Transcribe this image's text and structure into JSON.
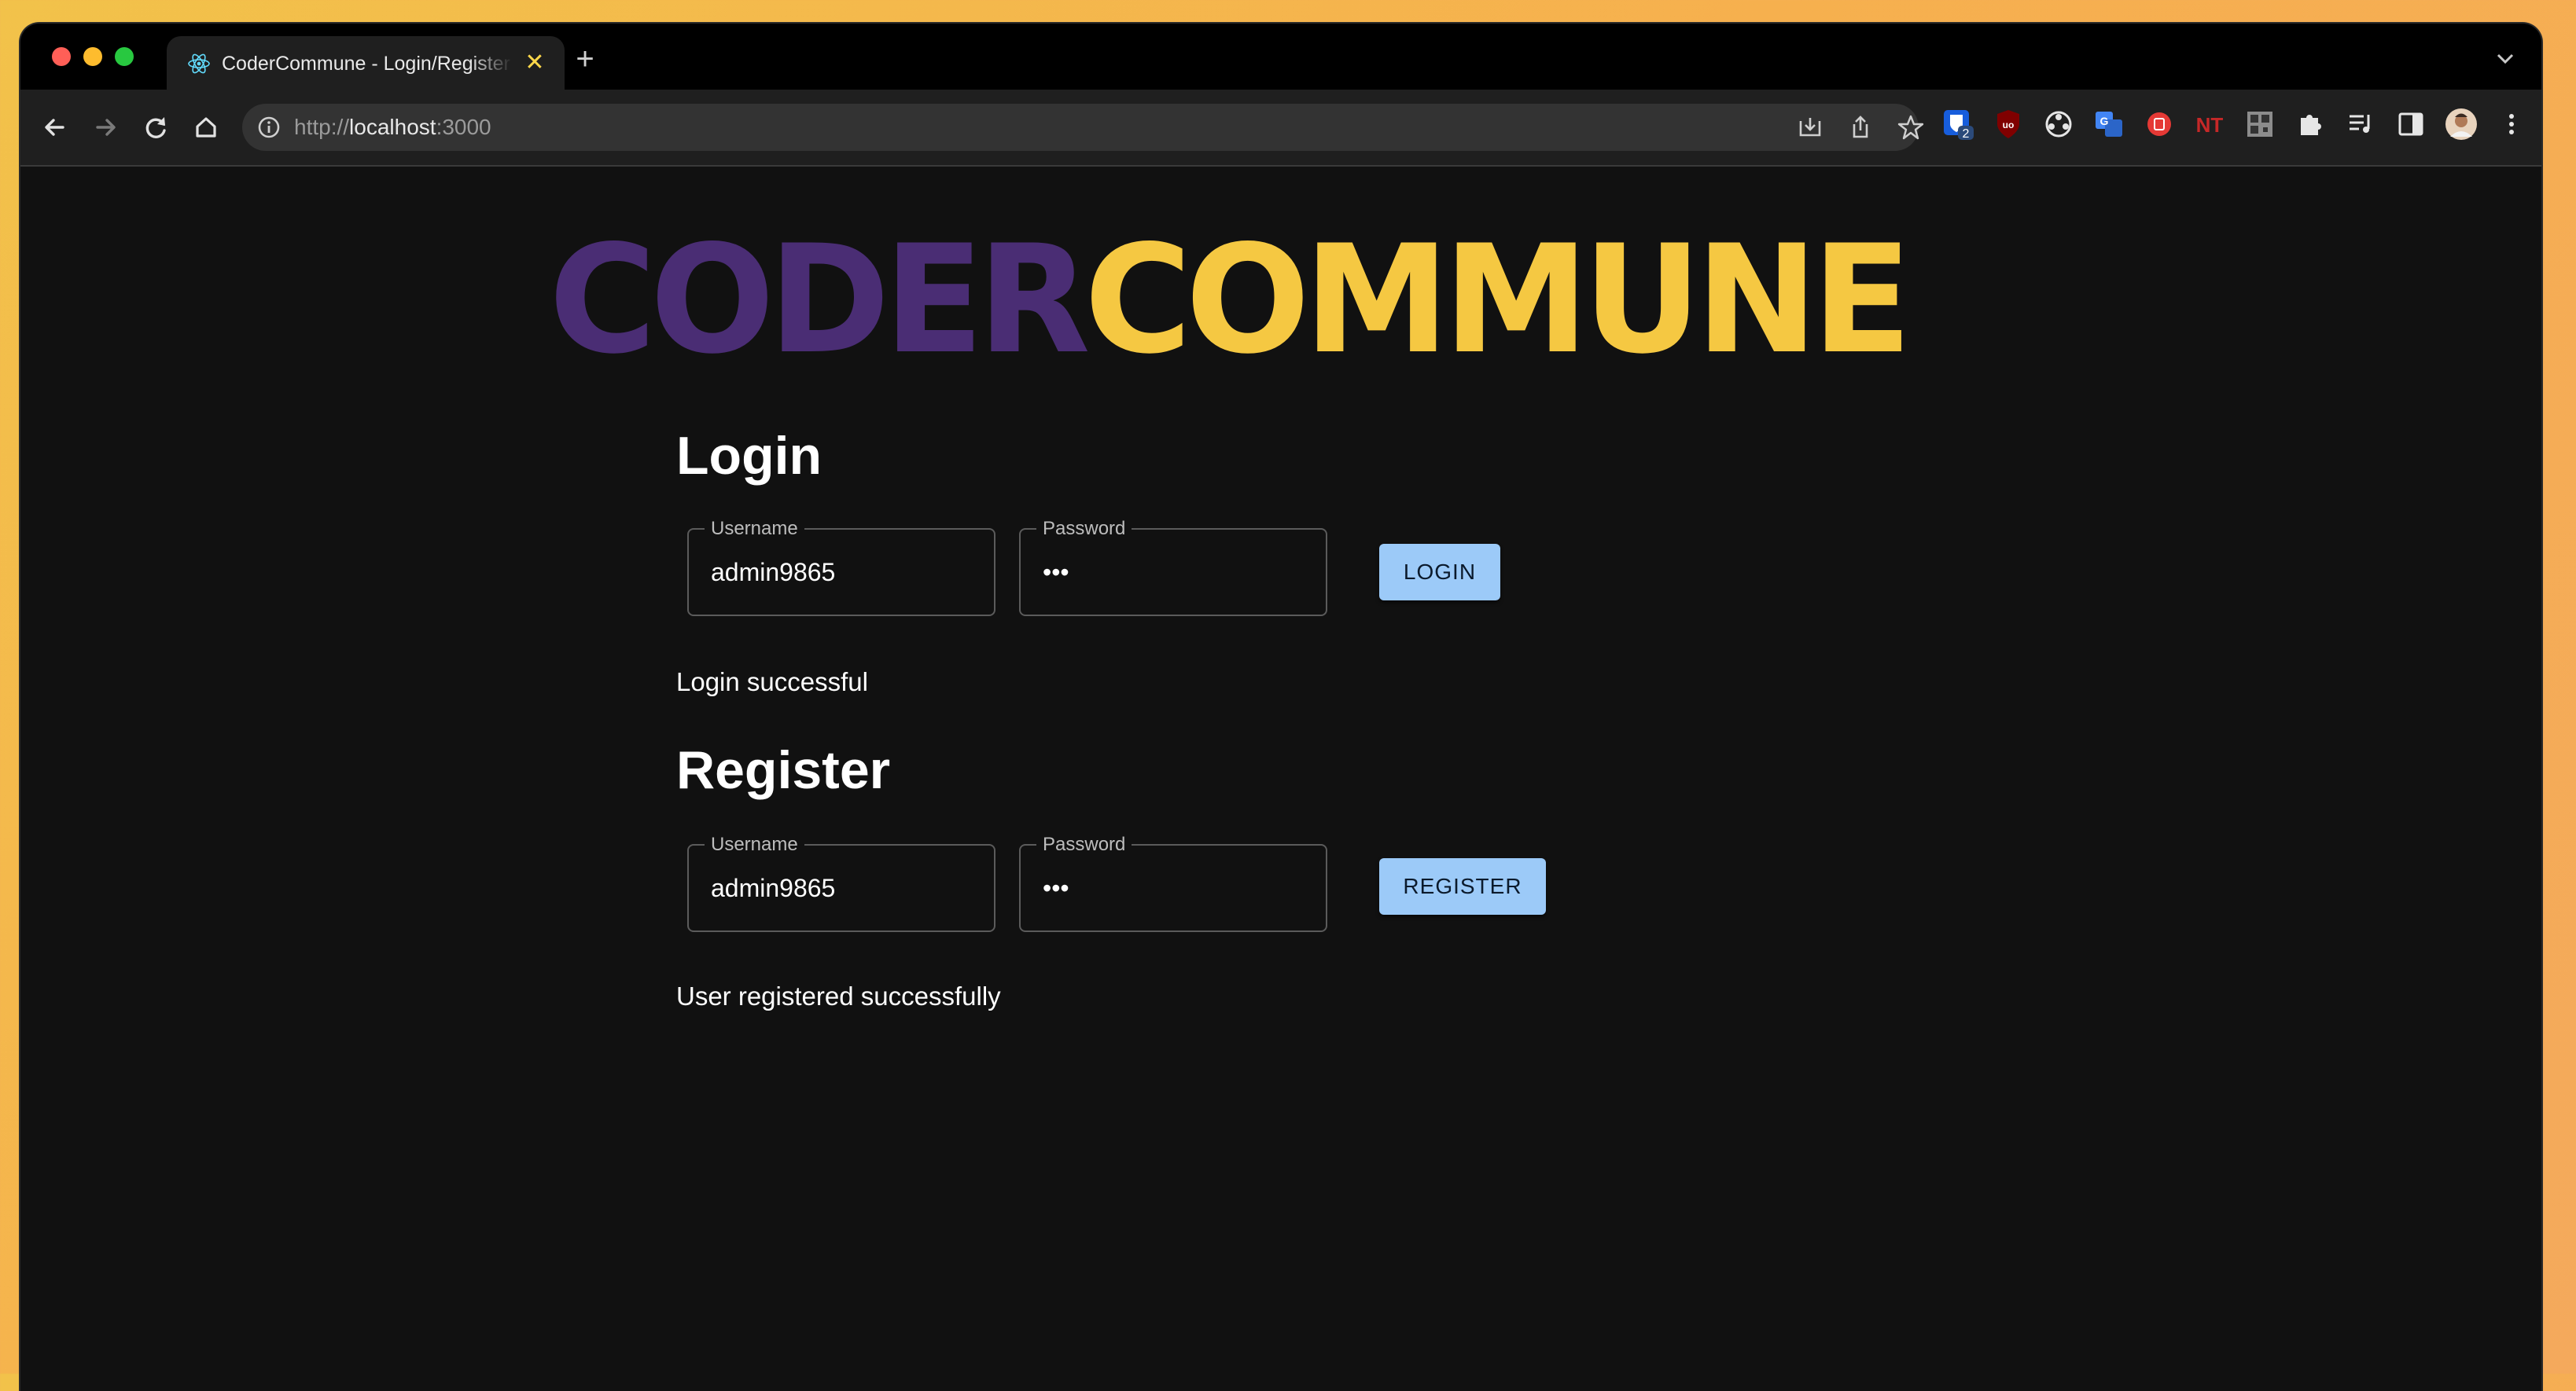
{
  "browser": {
    "tab_title": "CoderCommune - Login/Register",
    "tab_close": "✕",
    "new_tab": "+",
    "url_scheme": "http://",
    "url_host": "localhost",
    "url_port": ":3000",
    "extensions": [
      "bitwarden-icon",
      "ublock-icon",
      "extension-icon",
      "translate-icon",
      "adblock-icon",
      "netflix-icon",
      "qr-icon",
      "puzzle-icon",
      "media-icon",
      "sidepanel-icon",
      "profile-avatar",
      "menu-icon"
    ],
    "bitwarden_badge": "2",
    "netflix_label": "NT"
  },
  "logo": {
    "part1": "CODER",
    "part2": "COMMUNE"
  },
  "login": {
    "heading": "Login",
    "username_label": "Username",
    "username_value": "admin9865",
    "password_label": "Password",
    "password_value": "•••",
    "button_label": "LOGIN",
    "status": "Login successful"
  },
  "register": {
    "heading": "Register",
    "username_label": "Username",
    "username_value": "admin9865",
    "password_label": "Password",
    "password_value": "•••",
    "button_label": "REGISTER",
    "status": "User registered successfully"
  },
  "colors": {
    "logo_purple": "#4a2d74",
    "logo_yellow": "#f5c842",
    "button_bg": "#9ccaf8",
    "page_bg": "#111111"
  }
}
